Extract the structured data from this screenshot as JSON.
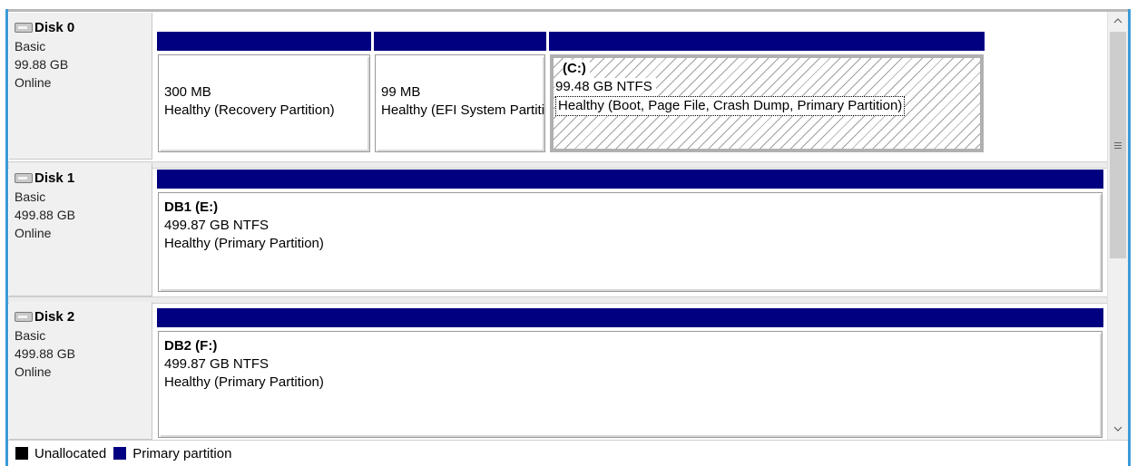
{
  "colors": {
    "primary_partition": "#000080",
    "unallocated": "#000000",
    "accent_border": "#3c9ad9"
  },
  "disks": [
    {
      "name": "Disk 0",
      "type": "Basic",
      "size": "99.88 GB",
      "status": "Online",
      "icon": "disk-icon",
      "partitions": [
        {
          "name": "",
          "size": "300 MB",
          "status": "Healthy (Recovery Partition)"
        },
        {
          "name": "",
          "size": "99 MB",
          "status": "Healthy (EFI System Partition)"
        },
        {
          "name": "(C:)",
          "size": "99.48 GB NTFS",
          "status": "Healthy (Boot, Page File, Crash Dump, Primary Partition)",
          "selected": true
        }
      ]
    },
    {
      "name": "Disk 1",
      "type": "Basic",
      "size": "499.88 GB",
      "status": "Online",
      "icon": "disk-icon",
      "partitions": [
        {
          "name": "DB1  (E:)",
          "size": "499.87 GB NTFS",
          "status": "Healthy (Primary Partition)"
        }
      ]
    },
    {
      "name": "Disk 2",
      "type": "Basic",
      "size": "499.88 GB",
      "status": "Online",
      "icon": "disk-icon",
      "partitions": [
        {
          "name": "DB2  (F:)",
          "size": "499.87 GB NTFS",
          "status": "Healthy (Primary Partition)"
        }
      ]
    }
  ],
  "legend": [
    {
      "label": "Unallocated",
      "color": "#000000"
    },
    {
      "label": "Primary partition",
      "color": "#000080"
    }
  ],
  "scrollbar": {
    "up_icon": "chevron-up-icon",
    "down_icon": "chevron-down-icon",
    "grip_icon": "grip-icon"
  }
}
